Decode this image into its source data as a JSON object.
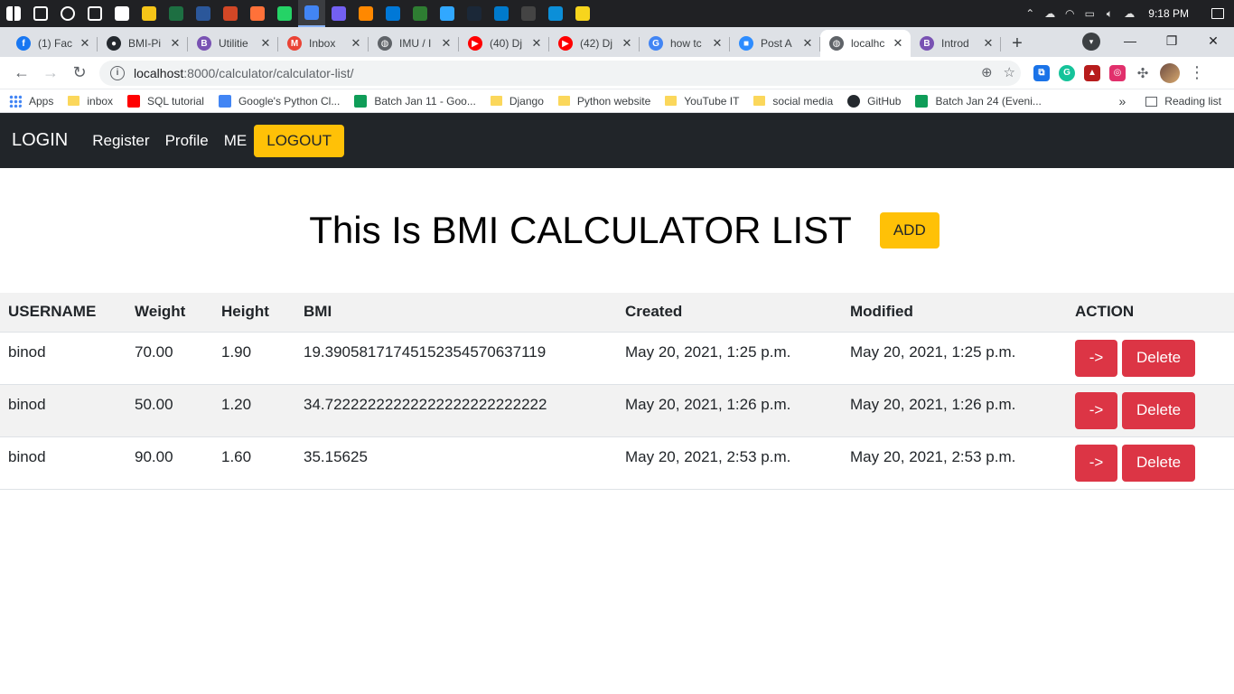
{
  "taskbar": {
    "icons": [
      {
        "name": "windows-start-icon",
        "color": "#ffffff"
      },
      {
        "name": "search-icon",
        "color": "#ffffff"
      },
      {
        "name": "cortana-icon",
        "color": "#ffffff"
      },
      {
        "name": "task-view-icon",
        "color": "#ffffff"
      },
      {
        "name": "store-icon",
        "color": "#ffffff"
      },
      {
        "name": "file-explorer-icon",
        "color": "#f5c518"
      },
      {
        "name": "excel-icon",
        "color": "#1d6f42"
      },
      {
        "name": "word-icon",
        "color": "#2b579a"
      },
      {
        "name": "powerpoint-icon",
        "color": "#d24726"
      },
      {
        "name": "firefox-icon",
        "color": "#ff7139"
      },
      {
        "name": "whatsapp-icon",
        "color": "#25d366"
      },
      {
        "name": "chrome-icon",
        "color": "#4285f4"
      },
      {
        "name": "viber-icon",
        "color": "#7360f2"
      },
      {
        "name": "vlc-icon",
        "color": "#ff8800"
      },
      {
        "name": "calendar-icon",
        "color": "#0078d7"
      },
      {
        "name": "green-app-icon",
        "color": "#2e7d32"
      },
      {
        "name": "photoshop-icon",
        "color": "#31a8ff"
      },
      {
        "name": "steam-icon",
        "color": "#1b2838"
      },
      {
        "name": "vscode-icon",
        "color": "#007acc"
      },
      {
        "name": "cmd-icon",
        "color": "#444444"
      },
      {
        "name": "edge-icon",
        "color": "#0c8fd8"
      },
      {
        "name": "sticky-notes-icon",
        "color": "#f7d51d"
      }
    ],
    "clock": "9:18 PM"
  },
  "tabs": [
    {
      "title": "(1) Fac",
      "favicon": "facebook-icon",
      "color": "#1877f2",
      "glyph": "f"
    },
    {
      "title": "BMI-Pi",
      "favicon": "github-icon",
      "color": "#24292e",
      "glyph": "●"
    },
    {
      "title": "Utilitie",
      "favicon": "bootstrap-icon",
      "color": "#7952b3",
      "glyph": "B"
    },
    {
      "title": "Inbox",
      "favicon": "gmail-icon",
      "color": "#ea4335",
      "glyph": "M"
    },
    {
      "title": "IMU / I",
      "favicon": "globe-icon",
      "color": "#5f6368",
      "glyph": "◍"
    },
    {
      "title": "(40) Dj",
      "favicon": "youtube-icon",
      "color": "#ff0000",
      "glyph": "▶"
    },
    {
      "title": "(42) Dj",
      "favicon": "youtube-icon",
      "color": "#ff0000",
      "glyph": "▶"
    },
    {
      "title": "how tc",
      "favicon": "google-icon",
      "color": "#4285f4",
      "glyph": "G"
    },
    {
      "title": "Post A",
      "favicon": "zoom-icon",
      "color": "#2d8cff",
      "glyph": "■"
    },
    {
      "title": "localhc",
      "favicon": "globe-icon",
      "color": "#5f6368",
      "glyph": "◍",
      "active": true
    },
    {
      "title": "Introd",
      "favicon": "bootstrap-icon",
      "color": "#7952b3",
      "glyph": "B"
    }
  ],
  "address": {
    "host": "localhost",
    "path": ":8000/calculator/calculator-list/"
  },
  "bookmarks": [
    {
      "label": "Apps",
      "icon": "apps-grid-icon",
      "color": "#4285f4"
    },
    {
      "label": "inbox",
      "icon": "folder-icon",
      "color": "#fbd75b"
    },
    {
      "label": "SQL tutorial",
      "icon": "youtube-icon",
      "color": "#ff0000"
    },
    {
      "label": "Google's Python Cl...",
      "icon": "code-icon",
      "color": "#4285f4"
    },
    {
      "label": "Batch Jan 11 - Goo...",
      "icon": "drive-icon",
      "color": "#0f9d58"
    },
    {
      "label": "Django",
      "icon": "folder-icon",
      "color": "#fbd75b"
    },
    {
      "label": "Python website",
      "icon": "folder-icon",
      "color": "#fbd75b"
    },
    {
      "label": "YouTube IT",
      "icon": "folder-icon",
      "color": "#fbd75b"
    },
    {
      "label": "social media",
      "icon": "folder-icon",
      "color": "#fbd75b"
    },
    {
      "label": "GitHub",
      "icon": "github-icon",
      "color": "#24292e"
    },
    {
      "label": "Batch Jan 24 (Eveni...",
      "icon": "drive-icon",
      "color": "#0f9d58"
    }
  ],
  "reading_list": "Reading list",
  "navbar": {
    "brand": "LOGIN",
    "links": [
      "Register",
      "Profile",
      "ME"
    ],
    "logout": "LOGOUT"
  },
  "page": {
    "title": "This Is BMI CALCULATOR LIST",
    "add_label": "ADD"
  },
  "table": {
    "headers": [
      "USERNAME",
      "Weight",
      "Height",
      "BMI",
      "Created",
      "Modified",
      "ACTION"
    ],
    "rows": [
      {
        "username": "binod",
        "weight": "70.00",
        "height": "1.90",
        "bmi": "19.390581717451523545706371 19",
        "created": "May 20, 2021, 1:25 p.m.",
        "modified": "May 20, 2021, 1:25 p.m."
      },
      {
        "username": "binod",
        "weight": "50.00",
        "height": "1.20",
        "bmi": "34.72222222222222222222222222",
        "created": "May 20, 2021, 1:26 p.m.",
        "modified": "May 20, 2021, 1:26 p.m."
      },
      {
        "username": "binod",
        "weight": "90.00",
        "height": "1.60",
        "bmi": "35.15625",
        "created": "May 20, 2021, 2:53 p.m.",
        "modified": "May 20, 2021, 2:53 p.m."
      }
    ],
    "view_label": "->",
    "delete_label": "Delete"
  },
  "colors": {
    "navbar_bg": "#212529",
    "warning": "#ffc107",
    "danger": "#dc3545",
    "stripe": "#f2f2f2"
  }
}
